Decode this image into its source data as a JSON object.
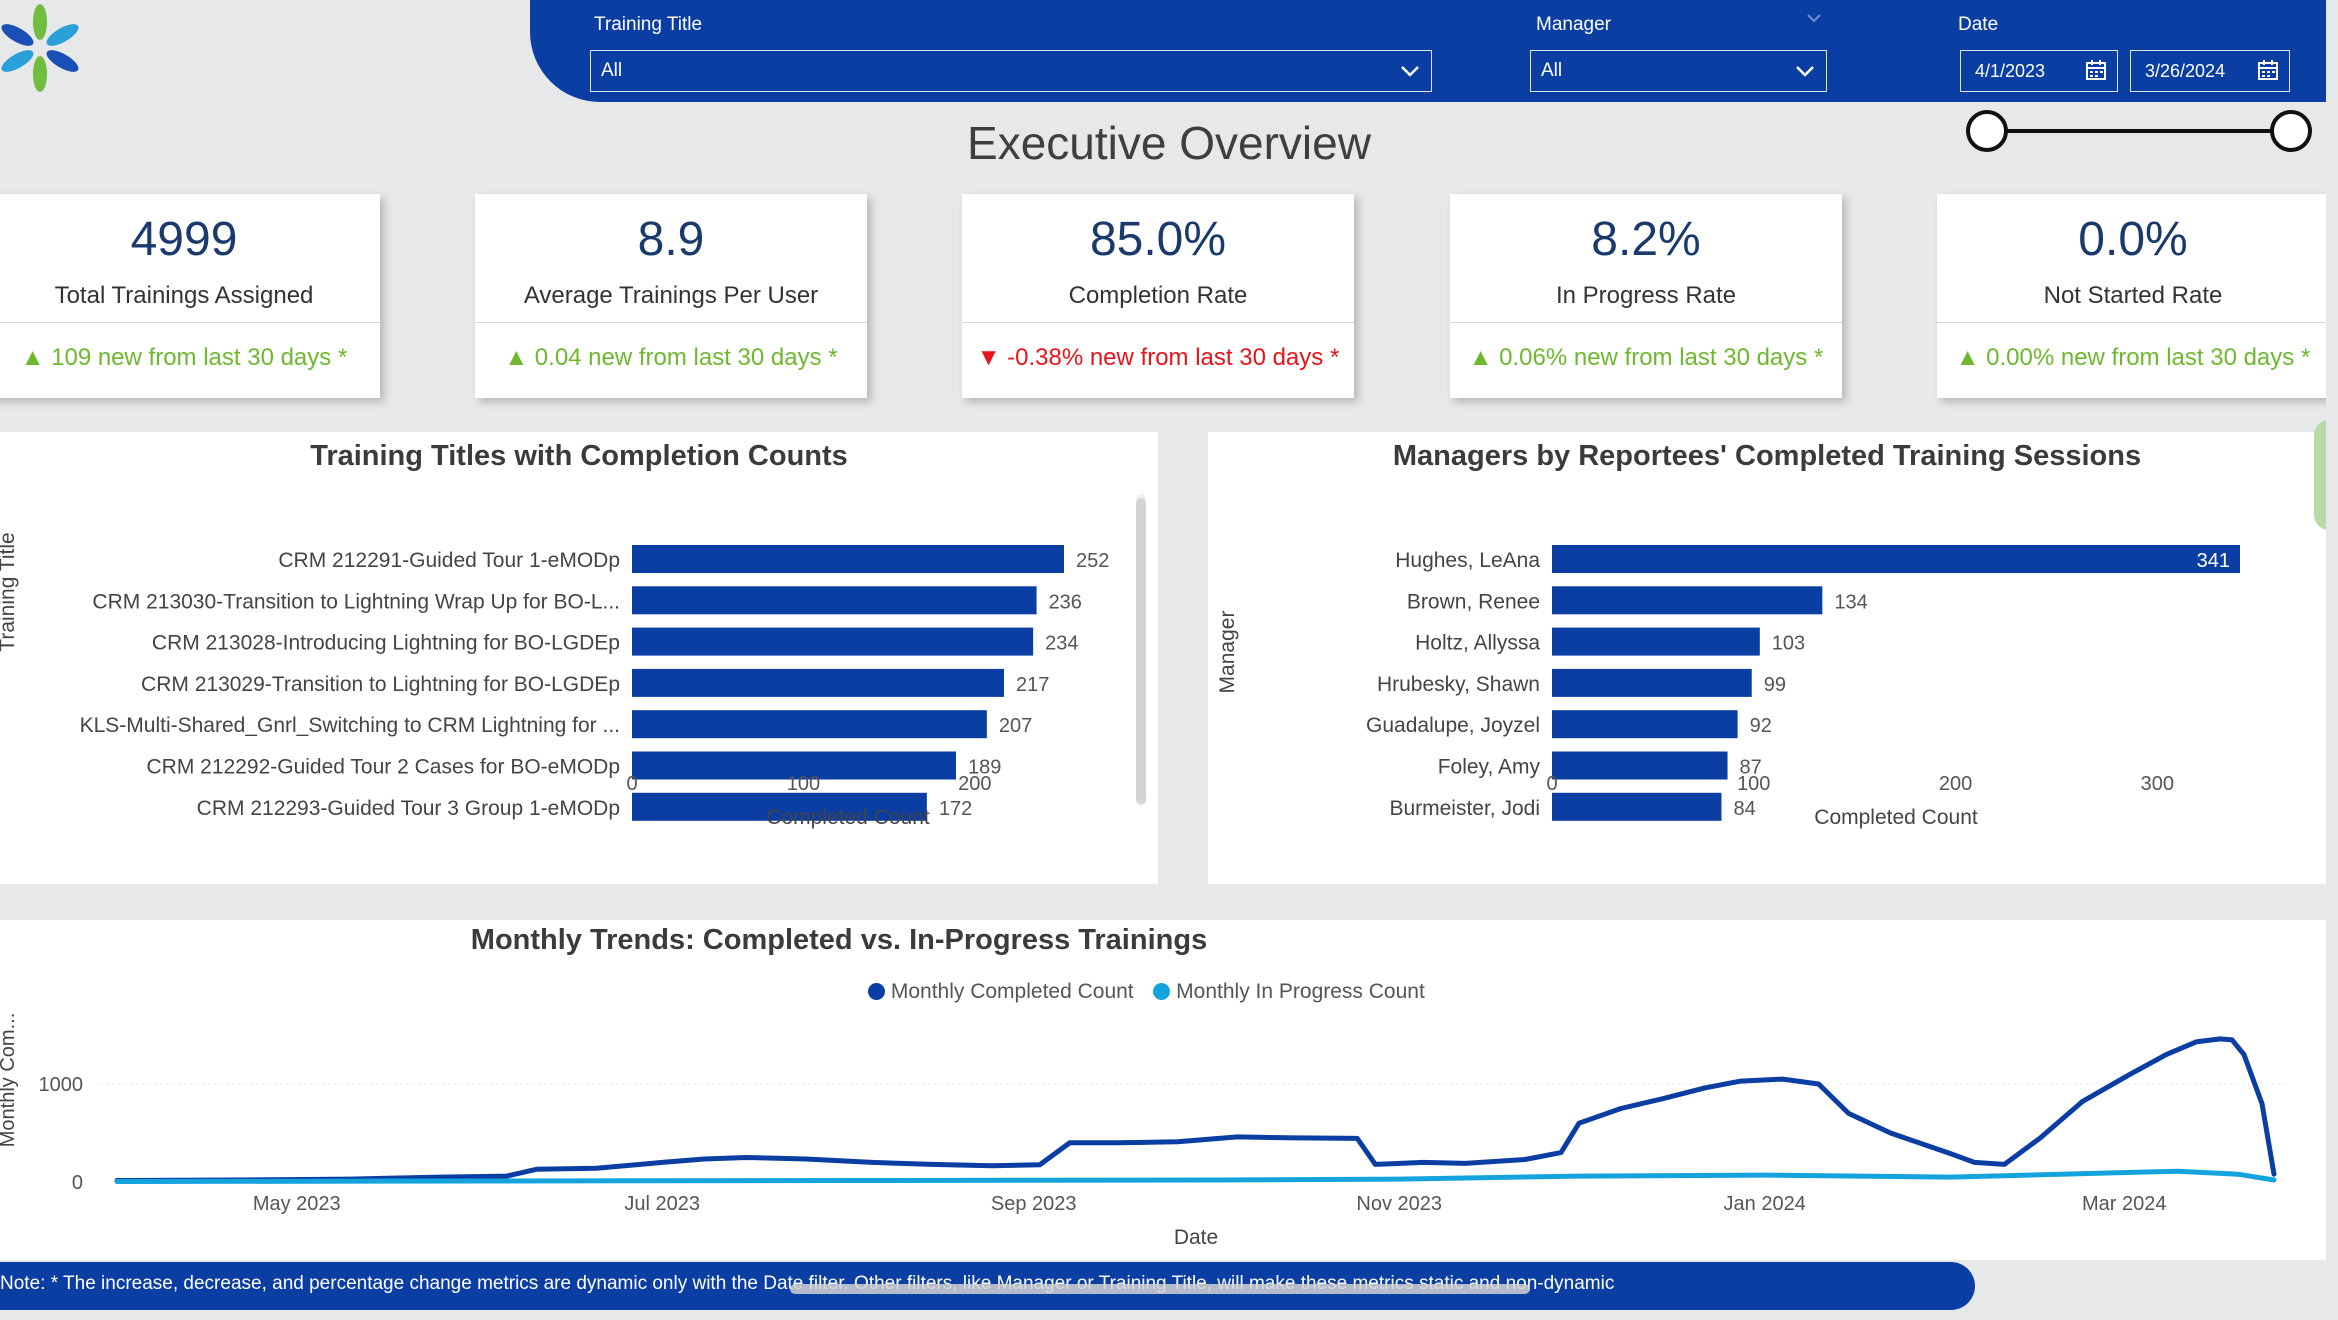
{
  "filters": {
    "training_title": {
      "label": "Training Title",
      "value": "All"
    },
    "manager": {
      "label": "Manager",
      "value": "All"
    },
    "date": {
      "label": "Date",
      "start": "4/1/2023",
      "end": "3/26/2024"
    }
  },
  "page_title": "Executive Overview",
  "kpis": [
    {
      "value": "4999",
      "label": "Total Trainings Assigned",
      "change": "109 new from last 30 days *",
      "direction": "up"
    },
    {
      "value": "8.9",
      "label": "Average Trainings Per User",
      "change": "0.04 new from last 30 days *",
      "direction": "up"
    },
    {
      "value": "85.0%",
      "label": "Completion Rate",
      "change": "-0.38% new from last 30 days *",
      "direction": "down"
    },
    {
      "value": "8.2%",
      "label": "In Progress Rate",
      "change": "0.06% new from last 30 days *",
      "direction": "up"
    },
    {
      "value": "0.0%",
      "label": "Not Started Rate",
      "change": "0.00% new from last 30 days *",
      "direction": "up"
    }
  ],
  "colors": {
    "accent": "#0b3ea3",
    "bar": "#0b3ea3",
    "line_completed": "#0b3ea3",
    "line_in_progress": "#14a3dc",
    "up": "#6eb82e",
    "down": "#e8141b"
  },
  "chart_data": [
    {
      "type": "bar",
      "orientation": "horizontal",
      "title": "Training Titles with Completion Counts",
      "xlabel": "Completed Count",
      "ylabel": "Training Title",
      "categories": [
        "CRM 212291-Guided Tour 1-eMODp",
        "CRM 213030-Transition to Lightning Wrap Up for BO-L...",
        "CRM 213028-Introducing Lightning for BO-LGDEp",
        "CRM 213029-Transition to Lightning for BO-LGDEp",
        "KLS-Multi-Shared_Gnrl_Switching to CRM Lightning for ...",
        "CRM 212292-Guided Tour 2 Cases for BO-eMODp",
        "CRM 212293-Guided Tour 3 Group 1-eMODp"
      ],
      "values": [
        252,
        236,
        234,
        217,
        207,
        189,
        172
      ],
      "xticks": [
        "0",
        "100",
        "200"
      ],
      "xlim": [
        0,
        252
      ]
    },
    {
      "type": "bar",
      "orientation": "horizontal",
      "title": "Managers by Reportees' Completed Training Sessions",
      "xlabel": "Completed Count",
      "ylabel": "Manager",
      "categories": [
        "Hughes, LeAna",
        "Brown, Renee",
        "Holtz, Allyssa",
        "Hrubesky, Shawn",
        "Guadalupe, Joyzel",
        "Foley, Amy",
        "Burmeister, Jodi"
      ],
      "values": [
        341,
        134,
        103,
        99,
        92,
        87,
        84
      ],
      "xticks": [
        "0",
        "100",
        "200",
        "300"
      ],
      "xlim": [
        0,
        341
      ]
    },
    {
      "type": "line",
      "title": "Monthly Trends: Completed vs. In-Progress Trainings",
      "xlabel": "Date",
      "ylabel": "Monthly Com...",
      "xticks": [
        "May 2023",
        "Jul 2023",
        "Sep 2023",
        "Nov 2023",
        "Jan 2024",
        "Mar 2024"
      ],
      "yticks": [
        "0",
        "1000"
      ],
      "ylim": [
        0,
        1500
      ],
      "xrange": [
        "2023-04-01",
        "2024-03-26"
      ],
      "series": [
        {
          "name": "Monthly Completed Count",
          "points": [
            [
              "2023-04-01",
              15
            ],
            [
              "2023-04-20",
              20
            ],
            [
              "2023-05-10",
              30
            ],
            [
              "2023-05-25",
              50
            ],
            [
              "2023-06-05",
              60
            ],
            [
              "2023-06-10",
              130
            ],
            [
              "2023-06-20",
              140
            ],
            [
              "2023-07-01",
              200
            ],
            [
              "2023-07-08",
              235
            ],
            [
              "2023-07-15",
              250
            ],
            [
              "2023-07-25",
              235
            ],
            [
              "2023-08-05",
              200
            ],
            [
              "2023-08-15",
              180
            ],
            [
              "2023-08-25",
              165
            ],
            [
              "2023-09-02",
              175
            ],
            [
              "2023-09-07",
              400
            ],
            [
              "2023-09-15",
              400
            ],
            [
              "2023-09-25",
              410
            ],
            [
              "2023-10-05",
              460
            ],
            [
              "2023-10-15",
              450
            ],
            [
              "2023-10-25",
              445
            ],
            [
              "2023-10-28",
              180
            ],
            [
              "2023-11-05",
              200
            ],
            [
              "2023-11-12",
              190
            ],
            [
              "2023-11-22",
              230
            ],
            [
              "2023-11-28",
              300
            ],
            [
              "2023-12-01",
              600
            ],
            [
              "2023-12-08",
              750
            ],
            [
              "2023-12-15",
              850
            ],
            [
              "2023-12-22",
              960
            ],
            [
              "2023-12-28",
              1030
            ],
            [
              "2024-01-04",
              1050
            ],
            [
              "2024-01-10",
              1000
            ],
            [
              "2024-01-15",
              700
            ],
            [
              "2024-01-22",
              500
            ],
            [
              "2024-02-01",
              290
            ],
            [
              "2024-02-05",
              200
            ],
            [
              "2024-02-10",
              180
            ],
            [
              "2024-02-16",
              450
            ],
            [
              "2024-02-23",
              820
            ],
            [
              "2024-03-02",
              1100
            ],
            [
              "2024-03-08",
              1300
            ],
            [
              "2024-03-13",
              1430
            ],
            [
              "2024-03-17",
              1460
            ],
            [
              "2024-03-19",
              1450
            ],
            [
              "2024-03-21",
              1300
            ],
            [
              "2024-03-24",
              800
            ],
            [
              "2024-03-26",
              80
            ]
          ]
        },
        {
          "name": "Monthly In Progress Count",
          "points": [
            [
              "2023-04-01",
              5
            ],
            [
              "2023-06-01",
              10
            ],
            [
              "2023-08-01",
              15
            ],
            [
              "2023-10-01",
              20
            ],
            [
              "2023-11-01",
              30
            ],
            [
              "2023-12-01",
              60
            ],
            [
              "2024-01-01",
              70
            ],
            [
              "2024-02-01",
              50
            ],
            [
              "2024-03-10",
              110
            ],
            [
              "2024-03-20",
              80
            ],
            [
              "2024-03-26",
              20
            ]
          ]
        }
      ]
    }
  ],
  "note": "Note: * The increase, decrease, and percentage change metrics are dynamic only with the Date filter. Other filters, like Manager or Training Title, will make these metrics static and non-dynamic"
}
